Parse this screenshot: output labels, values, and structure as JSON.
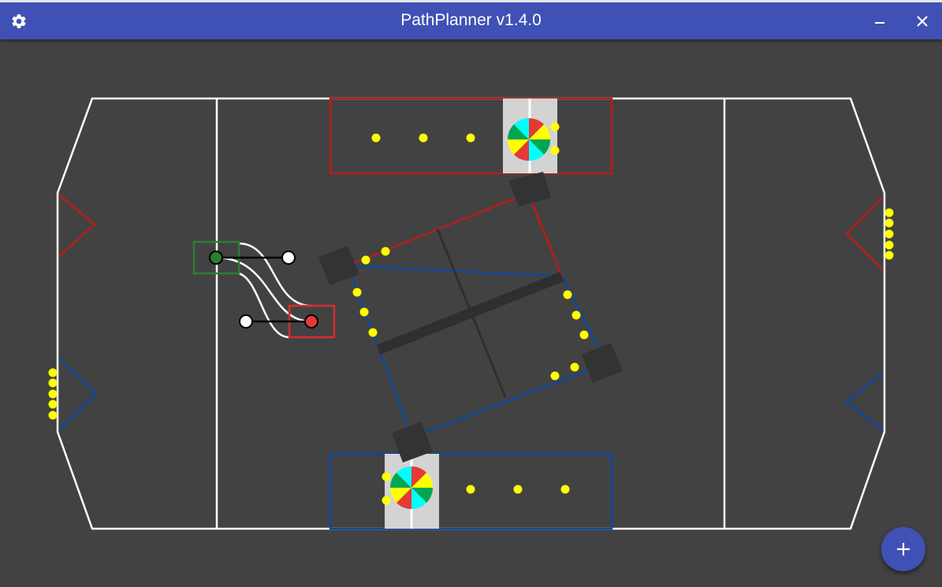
{
  "window": {
    "title": "PathPlanner v1.4.0",
    "accent_color": "#3f51b5",
    "background_color": "#424242"
  },
  "icons": {
    "settings": "gear-icon",
    "minimize": "minimize-icon",
    "close": "close-icon",
    "add": "plus-icon"
  },
  "path": {
    "start_waypoint_color": "#2e7d32",
    "end_waypoint_color": "#e53935",
    "control_point_color": "#ffffff",
    "path_color": "#ffffff"
  },
  "field": {
    "line_color": "#ffffff",
    "red_alliance_color": "#b71c1c",
    "blue_alliance_color": "#0d47a1",
    "power_cell_color": "#ffff00"
  }
}
